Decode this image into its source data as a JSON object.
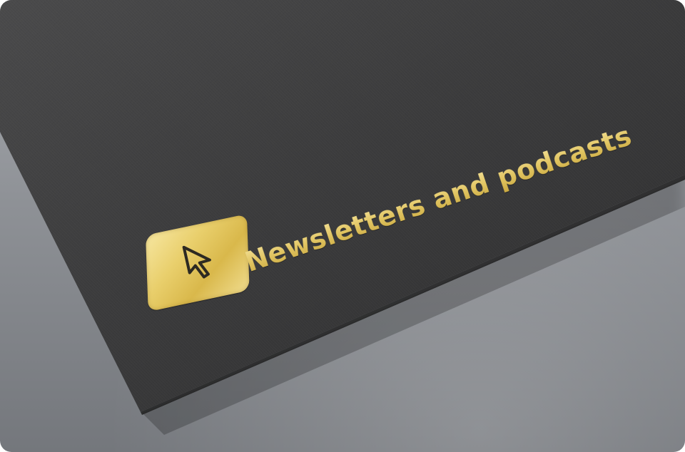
{
  "brand": {
    "name": "Newsletters and podcasts",
    "icon": "cursor-arrow-icon",
    "gold": "#e2c868",
    "paper": "#3c3c3d"
  },
  "scene": {
    "background": "#8e9196"
  }
}
